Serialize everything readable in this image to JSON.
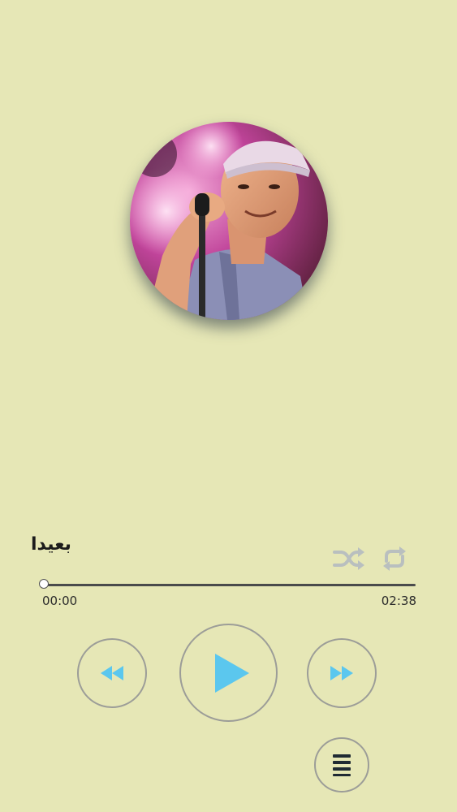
{
  "player": {
    "song_title": "بعيدا",
    "current_time": "00:00",
    "total_time": "02:38",
    "progress": 0,
    "is_playing": false
  },
  "icons": {
    "shuffle": "shuffle-icon",
    "repeat": "repeat-icon",
    "rewind": "rewind-icon",
    "play": "play-icon",
    "fast_forward": "fast-forward-icon",
    "playlist": "playlist-menu-icon"
  },
  "colors": {
    "background": "#e6e7b6",
    "accent": "#5bc7ee",
    "control_icon_muted": "#b9bfbf",
    "button_border": "#9c9d98",
    "track": "#4a4b4c"
  }
}
